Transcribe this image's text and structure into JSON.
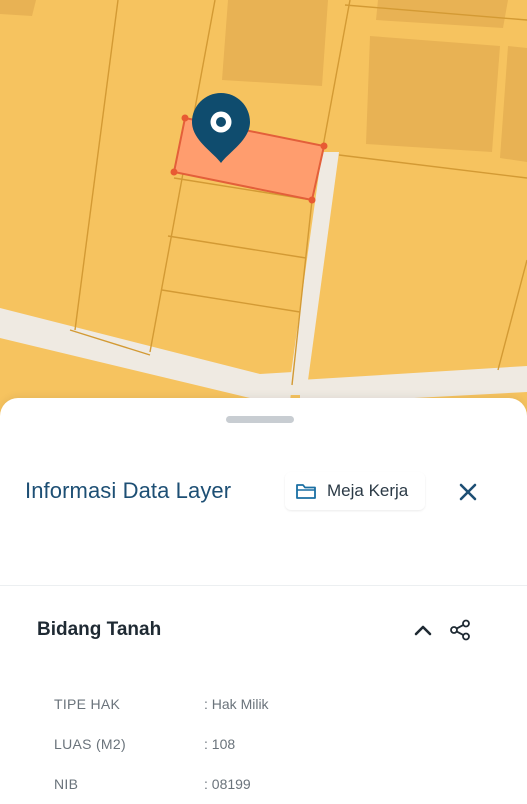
{
  "map": {
    "parcel_highlight_color": "#ff9d6e",
    "marker_color": "#0f4c6e",
    "marker_icon": "map-pin-icon"
  },
  "sheet": {
    "title": "Informasi Data Layer",
    "workspace_button": {
      "label": "Meja Kerja",
      "icon": "folder-icon"
    },
    "close_icon": "close-icon",
    "section": {
      "title": "Bidang Tanah",
      "collapse_icon": "chevron-up-icon",
      "share_icon": "share-icon",
      "rows": [
        {
          "key": "TIPE HAK",
          "value": ": Hak Milik"
        },
        {
          "key": "LUAS (M2)",
          "value": ": 108"
        },
        {
          "key": "NIB",
          "value": ": 08199"
        }
      ]
    }
  },
  "colors": {
    "title": "#1d4f74",
    "accent": "#1a6fa3",
    "map_fill": "#f6c35f"
  }
}
